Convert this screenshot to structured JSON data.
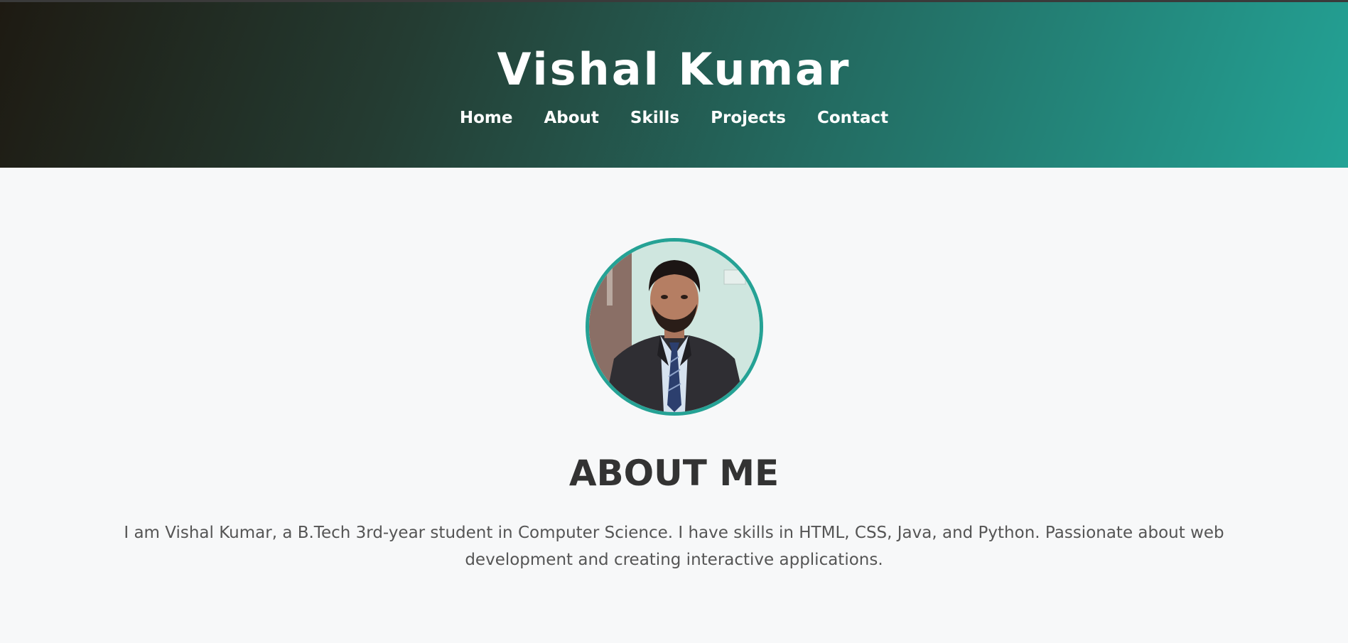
{
  "header": {
    "title": "Vishal Kumar",
    "nav": [
      "Home",
      "About",
      "Skills",
      "Projects",
      "Contact"
    ]
  },
  "about": {
    "heading": "ABOUT ME",
    "text": "I am Vishal Kumar, a B.Tech 3rd-year student in Computer Science. I have skills in HTML, CSS, Java, and Python. Passionate about web development and creating interactive applications."
  },
  "colors": {
    "accent": "#25a295",
    "header_dark": "#1e1a12",
    "header_light": "#23a396",
    "heading_text": "#333333",
    "body_text": "#555555",
    "page_background": "#f7f8f9"
  }
}
